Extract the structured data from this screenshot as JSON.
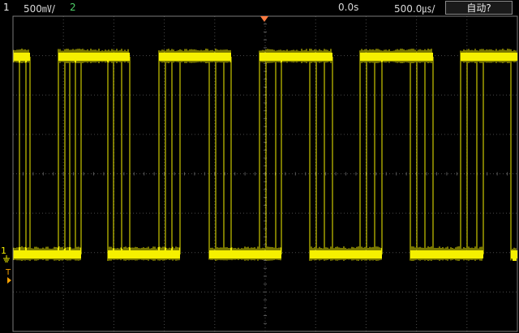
{
  "topbar": {
    "ch1_number": "1",
    "ch1_scale": "500㎷/",
    "ch2_number": "2",
    "time_delay": "0.0s",
    "time_scale": "500.0㎲/",
    "run_mode": "自动?"
  },
  "markers": {
    "ch1_ground": "1",
    "trigger_label": "T"
  },
  "colors": {
    "background": "#000000",
    "grid": "#4a4a4a",
    "frame": "#7a7a7a",
    "trace": "#f5f000",
    "trigger_marker": "#ff7a40",
    "ch2_label": "#4fd168"
  },
  "signal": {
    "type": "square wave",
    "period_divisions": 2.0,
    "duty_cycle": 0.5,
    "high_level_divisions": 2.5,
    "low_level_divisions": 0.0
  }
}
